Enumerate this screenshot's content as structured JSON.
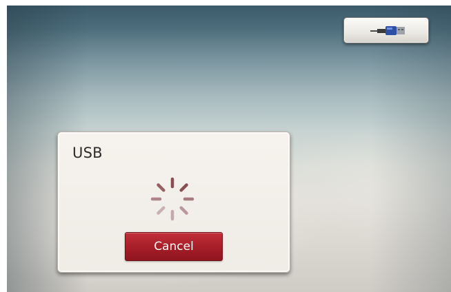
{
  "dialog": {
    "title": "USB",
    "cancel_label": "Cancel"
  },
  "status_indicator": {
    "icon": "usb-connector-icon"
  },
  "colors": {
    "cancel_button": "#a51d27",
    "spinner_active": "#8a4d52",
    "spinner_inactive": "#cdb8ba"
  }
}
